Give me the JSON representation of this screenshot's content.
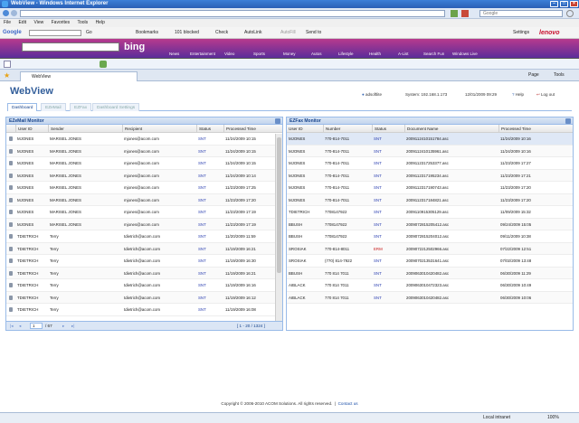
{
  "window": {
    "title": "WebView - Windows Internet Explorer"
  },
  "address": {
    "url": "",
    "search_placeholder": "Google"
  },
  "menu": [
    "File",
    "Edit",
    "View",
    "Favorites",
    "Tools",
    "Help"
  ],
  "google_toolbar": {
    "brand": "Google",
    "go_label": "Go",
    "bookmarks": "Bookmarks",
    "blocked": "101 blocked",
    "check": "Check",
    "autolink": "AutoLink",
    "autofill": "AutoFill",
    "send_to": "Send to",
    "settings": "Settings",
    "lenovo": "lenovo"
  },
  "bing": {
    "logo": "bing",
    "categories": [
      "News",
      "Entertainment",
      "Video",
      "Sports",
      "Money",
      "Autos",
      "Lifestyle",
      "Health",
      "A-List",
      "Search Fun",
      "Windows Live"
    ]
  },
  "ie_tab": {
    "label": "WebView"
  },
  "ie_tools": {
    "page": "Page",
    "tools": "Tools"
  },
  "app": {
    "title": "WebView",
    "user": "adsoftlite",
    "system": "System: 192.168.1.173",
    "datetime": "12/01/2009 09:29",
    "help": "Help",
    "logout": "Log out",
    "tabs": [
      "Dashboard",
      "EZeMail",
      "EZFax",
      "Dashboard Settings"
    ]
  },
  "ezemail": {
    "title": "EZeMail Monitor",
    "columns": [
      "User ID",
      "Sender",
      "Recipient",
      "Status",
      "Processed Time"
    ],
    "rows": [
      [
        "MJONES",
        "MARISEL JONES",
        "mjones@acom.com",
        "SNT",
        "11/24/2009 10:15"
      ],
      [
        "MJONES",
        "MARISEL JONES",
        "mjones@acom.com",
        "SNT",
        "11/24/2009 10:15"
      ],
      [
        "MJONES",
        "MARISEL JONES",
        "mjones@acom.com",
        "SNT",
        "11/24/2009 10:15"
      ],
      [
        "MJONES",
        "MARISEL JONES",
        "mjones@acom.com",
        "SNT",
        "11/24/2009 10:14"
      ],
      [
        "MJONES",
        "MARISEL JONES",
        "mjones@acom.com",
        "SNT",
        "11/23/2009 17:25"
      ],
      [
        "MJONES",
        "MARISEL JONES",
        "mjones@acom.com",
        "SNT",
        "11/23/2009 17:20"
      ],
      [
        "MJONES",
        "MARISEL JONES",
        "mjones@acom.com",
        "SNT",
        "11/23/2009 17:19"
      ],
      [
        "MJONES",
        "MARISEL JONES",
        "mjones@acom.com",
        "SNT",
        "11/23/2009 17:19"
      ],
      [
        "TDIETRICH",
        "Terry",
        "tdietrich@acom.com",
        "SNT",
        "11/20/2009 11:59"
      ],
      [
        "TDIETRICH",
        "Terry",
        "tdietrich@acom.com",
        "SNT",
        "11/19/2009 16:21"
      ],
      [
        "TDIETRICH",
        "Terry",
        "tdietrich@acom.com",
        "SNT",
        "11/19/2009 16:30"
      ],
      [
        "TDIETRICH",
        "Terry",
        "tdietrich@acom.com",
        "SNT",
        "11/19/2009 16:21"
      ],
      [
        "TDIETRICH",
        "Terry",
        "tdietrich@acom.com",
        "SNT",
        "11/19/2009 16:16"
      ],
      [
        "TDIETRICH",
        "Terry",
        "tdietrich@acom.com",
        "SNT",
        "11/19/2009 16:12"
      ],
      [
        "TDIETRICH",
        "Terry",
        "tdietrich@acom.com",
        "SNT",
        "11/19/2009 16:08"
      ]
    ],
    "pager": {
      "page": "1",
      "of": "/ 67",
      "range": "[ 1 - 20 / 1324 ]"
    }
  },
  "ezfax": {
    "title": "EZFax Monitor",
    "columns": [
      "User ID",
      "Number",
      "Status",
      "Document Name",
      "Processed Time"
    ],
    "rows": [
      [
        "MJONES",
        "770-814-7011",
        "SNT",
        "2009112410151784.asc",
        "11/24/2009 10:16"
      ],
      [
        "MJONES",
        "770-814-7011",
        "SNT",
        "2009112410135961.asc",
        "11/24/2009 10:16"
      ],
      [
        "MJONES",
        "770-814-7011",
        "SNT",
        "2009112317253377.asc",
        "11/23/2009 17:27"
      ],
      [
        "MJONES",
        "770-814-7011",
        "SNT",
        "2009112317195234.asc",
        "11/23/2009 17:21"
      ],
      [
        "MJONES",
        "770-814-7011",
        "SNT",
        "2009112317190743.asc",
        "11/23/2009 17:20"
      ],
      [
        "MJONES",
        "770-814-7011",
        "SNT",
        "2009112317184821.asc",
        "11/23/2009 17:20"
      ],
      [
        "TDIETRICH",
        "7708147922",
        "SNT",
        "2009110915305129.asc",
        "11/09/2009 15:32"
      ],
      [
        "BBUSH",
        "7708147922",
        "SNT",
        "2009072815205412.asc",
        "09/24/2009 15:05"
      ],
      [
        "BBUSH",
        "7708147922",
        "SNT",
        "2009072815204012.asc",
        "09/11/2009 10:38"
      ],
      [
        "SROSIAK",
        "770-814-8011",
        "ERM",
        "2009072212502966.asc",
        "07/22/2009 12:51"
      ],
      [
        "SROSIAK",
        "(770) 814-7922",
        "SNT",
        "2009070213531641.asc",
        "07/02/2009 13:48"
      ],
      [
        "BBUSH",
        "770 814 7011",
        "SNT",
        "2009063010420482.asc",
        "06/30/2009 11:29"
      ],
      [
        "AIBLACK",
        "770 814 7011",
        "SNT",
        "2009063010472323.asc",
        "06/30/2009 10:49"
      ],
      [
        "AIBLACK",
        "770 814 7011",
        "SNT",
        "2009063010420482.asc",
        "06/30/2009 10:06"
      ]
    ]
  },
  "footer": {
    "copyright": "Copyright © 2006-2010 ACOM Solutions. All rights reserved.",
    "contact": "Contact us"
  },
  "statusbar": {
    "zone": "Local intranet",
    "zoom": "100%"
  }
}
